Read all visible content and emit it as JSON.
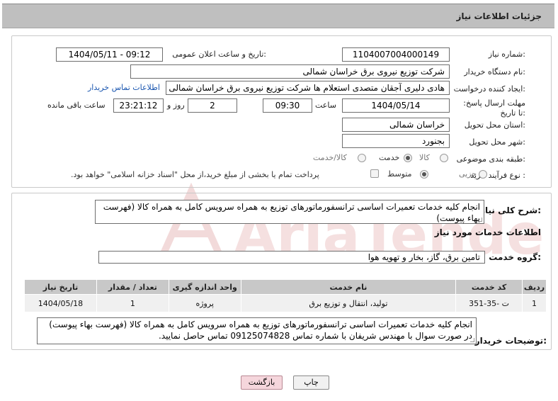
{
  "header": {
    "title": "جزئیات اطلاعات نیاز"
  },
  "fields": {
    "need_number": {
      "label": "شماره نیاز:",
      "value": "1104007004000149"
    },
    "announce_datetime": {
      "label": "تاریخ و ساعت اعلان عمومی:",
      "value": "1404/05/11 - 09:12"
    },
    "buyer_org": {
      "label": "نام دستگاه خریدار:",
      "value": "شرکت توزیع نیروی برق خراسان شمالی"
    },
    "requester": {
      "label": "ایجاد کننده درخواست:",
      "value": "هادی دلیری آجقان متصدی استعلام ها شرکت توزیع نیروی برق خراسان شمالی",
      "link": "اطلاعات تماس خریدار"
    },
    "deadline": {
      "label": "مهلت ارسال پاسخ: تا تاریخ:",
      "date": "1404/05/14",
      "time_label": "ساعت",
      "time": "09:30",
      "days": "2",
      "days_label": "روز و",
      "remaining": "23:21:12",
      "remaining_label": "ساعت باقی مانده"
    },
    "delivery_province": {
      "label": "استان محل تحویل:",
      "value": "خراسان شمالی"
    },
    "delivery_city": {
      "label": "شهر محل تحویل:",
      "value": "بجنورد"
    },
    "category": {
      "label": "طبقه بندی موضوعی:",
      "options": [
        "کالا",
        "خدمت",
        "کالا/خدمت"
      ],
      "selected": "خدمت"
    },
    "purchase_type": {
      "label": "نوع فرآیند خرید :",
      "options": [
        "جزیی",
        "متوسط"
      ],
      "selected": "متوسط",
      "payment_note": "پرداخت تمام یا بخشی از مبلغ خرید،از محل \"اسناد خزانه اسلامی\" خواهد بود."
    }
  },
  "summary": {
    "label": "شرح کلی نیاز:",
    "text": "انجام کلیه خدمات تعمیرات اساسی ترانسفورماتورهای توزیع به همراه سرویس کامل به همراه کالا (فهرست بهاء پیوست)"
  },
  "services": {
    "section_title": "اطلاعات خدمات مورد نیاز",
    "group_label": "گروه خدمت:",
    "group_value": "تامین برق، گاز، بخار و تهویه هوا",
    "table": {
      "headers": [
        "ردیف",
        "کد خدمت",
        "نام خدمت",
        "واحد اندازه گیری",
        "تعداد / مقدار",
        "تاریخ نیاز"
      ],
      "rows": [
        [
          "1",
          "ت -35-351",
          "تولید، انتقال و توزیع برق",
          "پروژه",
          "1",
          "1404/05/18"
        ]
      ]
    }
  },
  "buyer_notes": {
    "label": "توضیحات خریدار:",
    "text": "انجام کلیه خدمات تعمیرات اساسی ترانسفورماتورهای توزیع به همراه سرویس کامل به همراه کالا (فهرست بهاء پیوست)  در صورت سوال با مهندس شریفان با شماره تماس 09125074828 تماس حاصل نمایید."
  },
  "buttons": {
    "print": "چاپ",
    "back": "بازگشت"
  },
  "colors": {
    "header_bg": "#bfbfbf",
    "link": "#1a56b0",
    "back_button": "#f5d6dc",
    "watermark": "#e7b3b3"
  }
}
